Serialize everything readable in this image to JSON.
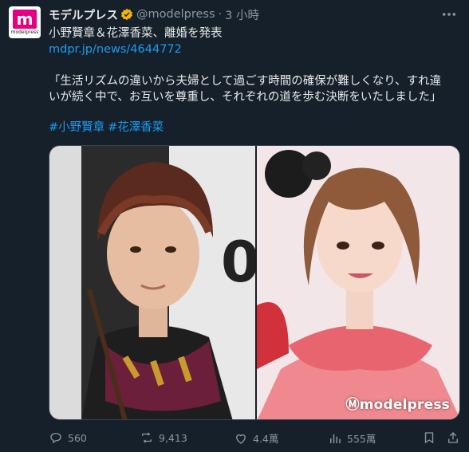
{
  "post": {
    "author_name": "モデルプレス",
    "handle": "@modelpress",
    "separator": "·",
    "time": "3 小時",
    "headline": "小野賢章＆花澤香菜、離婚を発表",
    "link": "mdpr.jp/news/4644772",
    "quote_line1": "「生活リズムの違いから夫婦として過ごす時間の確保が難しくなり、すれ違",
    "quote_line2": "いが続く中で、お互いを尊重し、それぞれの道を歩む決断をいたしました」",
    "hashtags": [
      "#小野賢章",
      "#花澤香菜"
    ]
  },
  "avatar": {
    "mark": "m",
    "word": "modelpress"
  },
  "media": {
    "watermark": "Ⓜmodelpress"
  },
  "metrics": {
    "replies": "560",
    "reposts": "9,413",
    "likes": "4.4萬",
    "views": "555萬"
  },
  "colors": {
    "background": "#15202b",
    "text": "#e7e9ea",
    "secondary": "#8b98a5",
    "link": "#1d9bf0",
    "brand": "#e4007f",
    "verified": "#f4b400"
  },
  "icons": [
    "verified-badge-icon",
    "more-icon",
    "reply-icon",
    "repost-icon",
    "like-icon",
    "views-icon",
    "bookmark-icon",
    "share-icon"
  ]
}
